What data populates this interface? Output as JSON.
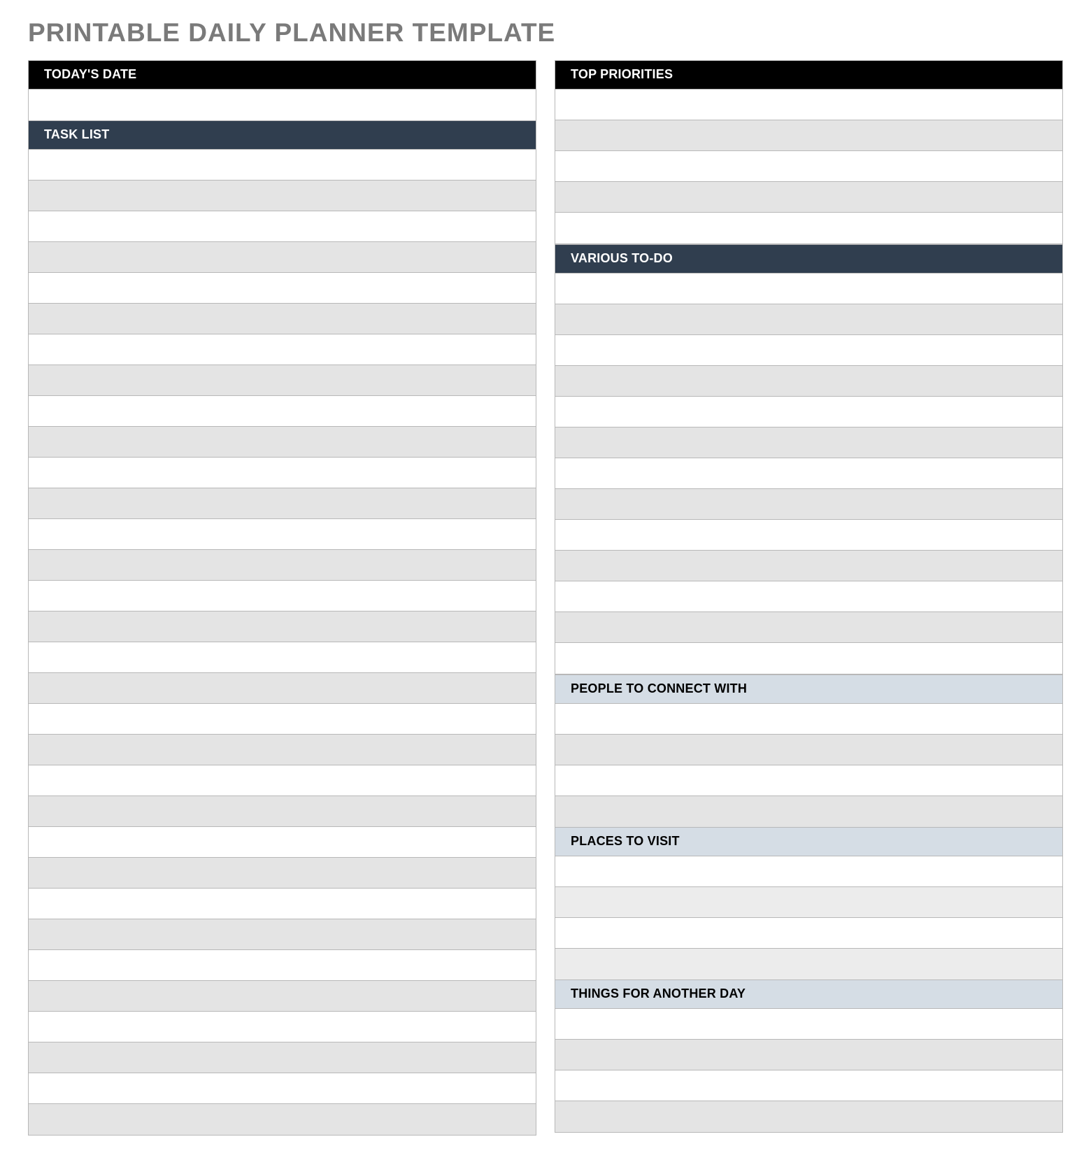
{
  "title": "PRINTABLE DAILY PLANNER TEMPLATE",
  "left": {
    "todaysDate": {
      "header": "TODAY'S DATE",
      "value": ""
    },
    "taskList": {
      "header": "TASK LIST",
      "rows": [
        "",
        "",
        "",
        "",
        "",
        "",
        "",
        "",
        "",
        "",
        "",
        "",
        "",
        "",
        "",
        "",
        "",
        "",
        "",
        "",
        "",
        "",
        "",
        "",
        "",
        "",
        "",
        "",
        "",
        "",
        "",
        ""
      ]
    }
  },
  "right": {
    "topPriorities": {
      "header": "TOP PRIORITIES",
      "rows": [
        "",
        "",
        "",
        "",
        ""
      ]
    },
    "variousToDo": {
      "header": "VARIOUS TO-DO",
      "rows": [
        "",
        "",
        "",
        "",
        "",
        "",
        "",
        "",
        "",
        "",
        "",
        "",
        ""
      ]
    },
    "peopleToConnect": {
      "header": "PEOPLE TO CONNECT WITH",
      "rows": [
        "",
        "",
        "",
        ""
      ]
    },
    "placesToVisit": {
      "header": "PLACES TO VISIT",
      "rows": [
        "",
        "",
        "",
        ""
      ]
    },
    "thingsAnotherDay": {
      "header": "THINGS FOR ANOTHER DAY",
      "rows": [
        "",
        "",
        "",
        ""
      ]
    }
  }
}
